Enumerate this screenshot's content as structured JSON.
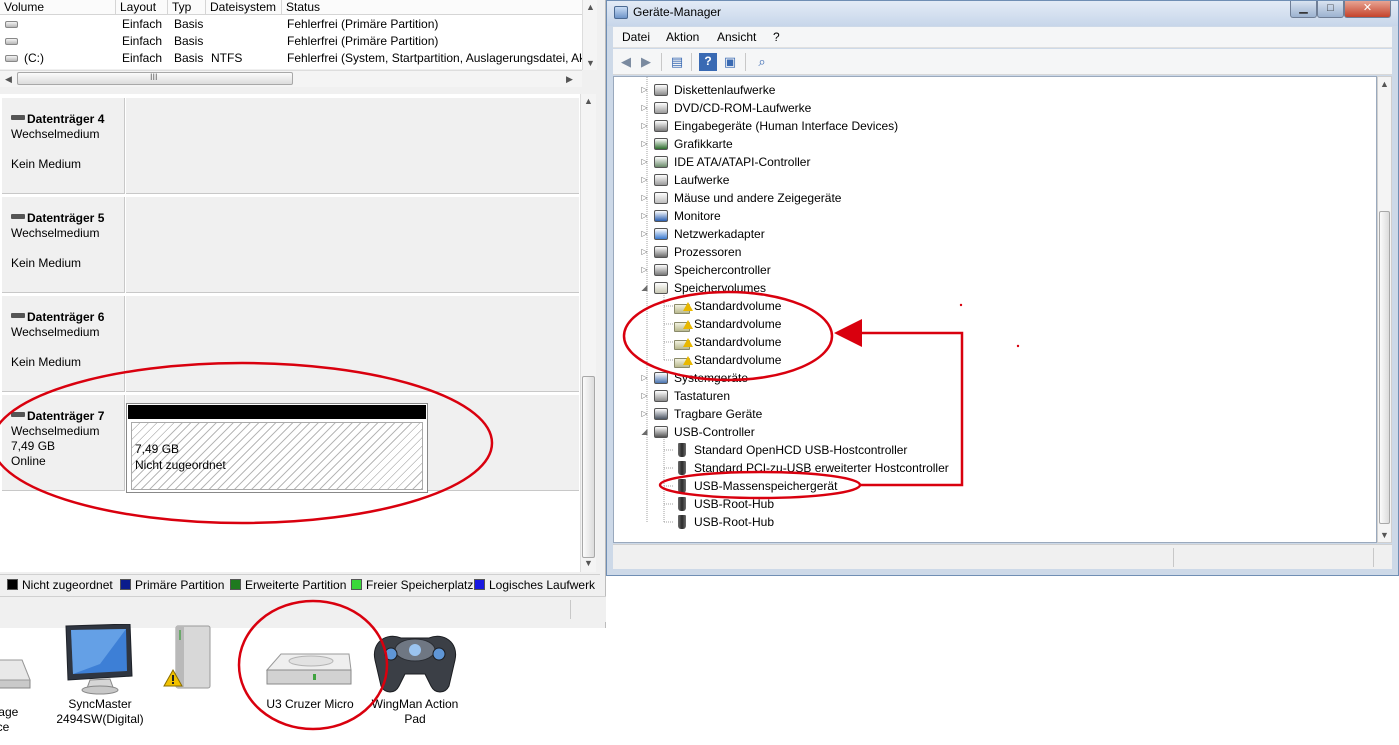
{
  "volume_list": {
    "headers": [
      "Volume",
      "Layout",
      "Typ",
      "Dateisystem",
      "Status"
    ],
    "rows": [
      {
        "volume": "",
        "layout": "Einfach",
        "typ": "Basis",
        "dateisystem": "",
        "status": "Fehlerfrei (Primäre Partition)"
      },
      {
        "volume": "",
        "layout": "Einfach",
        "typ": "Basis",
        "dateisystem": "",
        "status": "Fehlerfrei (Primäre Partition)"
      },
      {
        "volume": "(C:)",
        "layout": "Einfach",
        "typ": "Basis",
        "dateisystem": "NTFS",
        "status": "Fehlerfrei (System, Startpartition, Auslagerungsdatei, Ak"
      }
    ],
    "hscroll_thumb_glyph": "III"
  },
  "disks": [
    {
      "name": "Datenträger 4",
      "type": "Wechselmedium",
      "size": "",
      "state": "Kein Medium"
    },
    {
      "name": "Datenträger 5",
      "type": "Wechselmedium",
      "size": "",
      "state": "Kein Medium"
    },
    {
      "name": "Datenträger 6",
      "type": "Wechselmedium",
      "size": "",
      "state": "Kein Medium"
    },
    {
      "name": "Datenträger 7",
      "type": "Wechselmedium",
      "size": "7,49 GB",
      "state": "Online"
    }
  ],
  "partition": {
    "size": "7,49 GB",
    "status": "Nicht zugeordnet"
  },
  "legend": [
    {
      "label": "Nicht zugeordnet",
      "color": "#000000"
    },
    {
      "label": "Primäre Partition",
      "color": "#0b1c8c"
    },
    {
      "label": "Erweiterte Partition",
      "color": "#1f7a1f"
    },
    {
      "label": "Freier Speicherplatz",
      "color": "#3ad83a"
    },
    {
      "label": "Logisches Laufwerk",
      "color": "#1818e0"
    }
  ],
  "devices": [
    {
      "label_line1": "orage",
      "label_line2": "ce",
      "icon": "storage-drive-icon"
    },
    {
      "label_line1": "SyncMaster",
      "label_line2": "2494SW(Digital)",
      "icon": "monitor-icon"
    },
    {
      "label_line1": "",
      "label_line2": "",
      "icon": "external-drive-warning-icon"
    },
    {
      "label_line1": "U3 Cruzer Micro",
      "label_line2": "",
      "icon": "usb-drive-icon"
    },
    {
      "label_line1": "WingMan Action",
      "label_line2": "Pad",
      "icon": "gamepad-icon"
    }
  ],
  "device_manager": {
    "title": "Geräte-Manager",
    "window_buttons": {
      "minimize": "▁",
      "maximize": "□",
      "close": "✕"
    },
    "menu": [
      "Datei",
      "Aktion",
      "Ansicht",
      "?"
    ],
    "toolbar": [
      "back-icon",
      "forward-icon",
      "properties-icon",
      "help-icon",
      "show-hide-icon",
      "scan-hardware-icon"
    ],
    "tree": [
      {
        "label": "Diskettenlaufwerke",
        "level": 0,
        "expander": "▷",
        "icon": "floppy-icon"
      },
      {
        "label": "DVD/CD-ROM-Laufwerke",
        "level": 0,
        "expander": "▷",
        "icon": "dvd-drive-icon"
      },
      {
        "label": "Eingabegeräte (Human Interface Devices)",
        "level": 0,
        "expander": "▷",
        "icon": "hid-icon"
      },
      {
        "label": "Grafikkarte",
        "level": 0,
        "expander": "▷",
        "icon": "display-adapter-icon"
      },
      {
        "label": "IDE ATA/ATAPI-Controller",
        "level": 0,
        "expander": "▷",
        "icon": "ide-controller-icon"
      },
      {
        "label": "Laufwerke",
        "level": 0,
        "expander": "▷",
        "icon": "disk-drive-icon"
      },
      {
        "label": "Mäuse und andere Zeigegeräte",
        "level": 0,
        "expander": "▷",
        "icon": "mouse-icon"
      },
      {
        "label": "Monitore",
        "level": 0,
        "expander": "▷",
        "icon": "monitor-icon"
      },
      {
        "label": "Netzwerkadapter",
        "level": 0,
        "expander": "▷",
        "icon": "network-adapter-icon"
      },
      {
        "label": "Prozessoren",
        "level": 0,
        "expander": "▷",
        "icon": "processor-icon"
      },
      {
        "label": "Speichercontroller",
        "level": 0,
        "expander": "▷",
        "icon": "storage-controller-icon"
      },
      {
        "label": "Speichervolumes",
        "level": 0,
        "expander": "◢",
        "icon": "storage-volumes-icon"
      },
      {
        "label": "Standardvolume",
        "level": 1,
        "expander": "",
        "icon": "volume-warning-icon"
      },
      {
        "label": "Standardvolume",
        "level": 1,
        "expander": "",
        "icon": "volume-warning-icon"
      },
      {
        "label": "Standardvolume",
        "level": 1,
        "expander": "",
        "icon": "volume-warning-icon"
      },
      {
        "label": "Standardvolume",
        "level": 1,
        "expander": "",
        "icon": "volume-warning-icon"
      },
      {
        "label": "Systemgeräte",
        "level": 0,
        "expander": "▷",
        "icon": "system-devices-icon"
      },
      {
        "label": "Tastaturen",
        "level": 0,
        "expander": "▷",
        "icon": "keyboard-icon"
      },
      {
        "label": "Tragbare Geräte",
        "level": 0,
        "expander": "▷",
        "icon": "portable-devices-icon"
      },
      {
        "label": "USB-Controller",
        "level": 0,
        "expander": "◢",
        "icon": "usb-controller-icon"
      },
      {
        "label": "Standard OpenHCD USB-Hostcontroller",
        "level": 1,
        "expander": "",
        "icon": "usb-plug-icon"
      },
      {
        "label": "Standard PCI-zu-USB erweiterter Hostcontroller",
        "level": 1,
        "expander": "",
        "icon": "usb-plug-icon"
      },
      {
        "label": "USB-Massenspeichergerät",
        "level": 1,
        "expander": "",
        "icon": "usb-plug-icon"
      },
      {
        "label": "USB-Root-Hub",
        "level": 1,
        "expander": "",
        "icon": "usb-plug-icon"
      },
      {
        "label": "USB-Root-Hub",
        "level": 1,
        "expander": "",
        "icon": "usb-plug-icon"
      }
    ]
  },
  "colors": {
    "annotation": "#d9000e",
    "window_frame": "#cdd9e8",
    "panel_bg": "#f0f0f0"
  }
}
